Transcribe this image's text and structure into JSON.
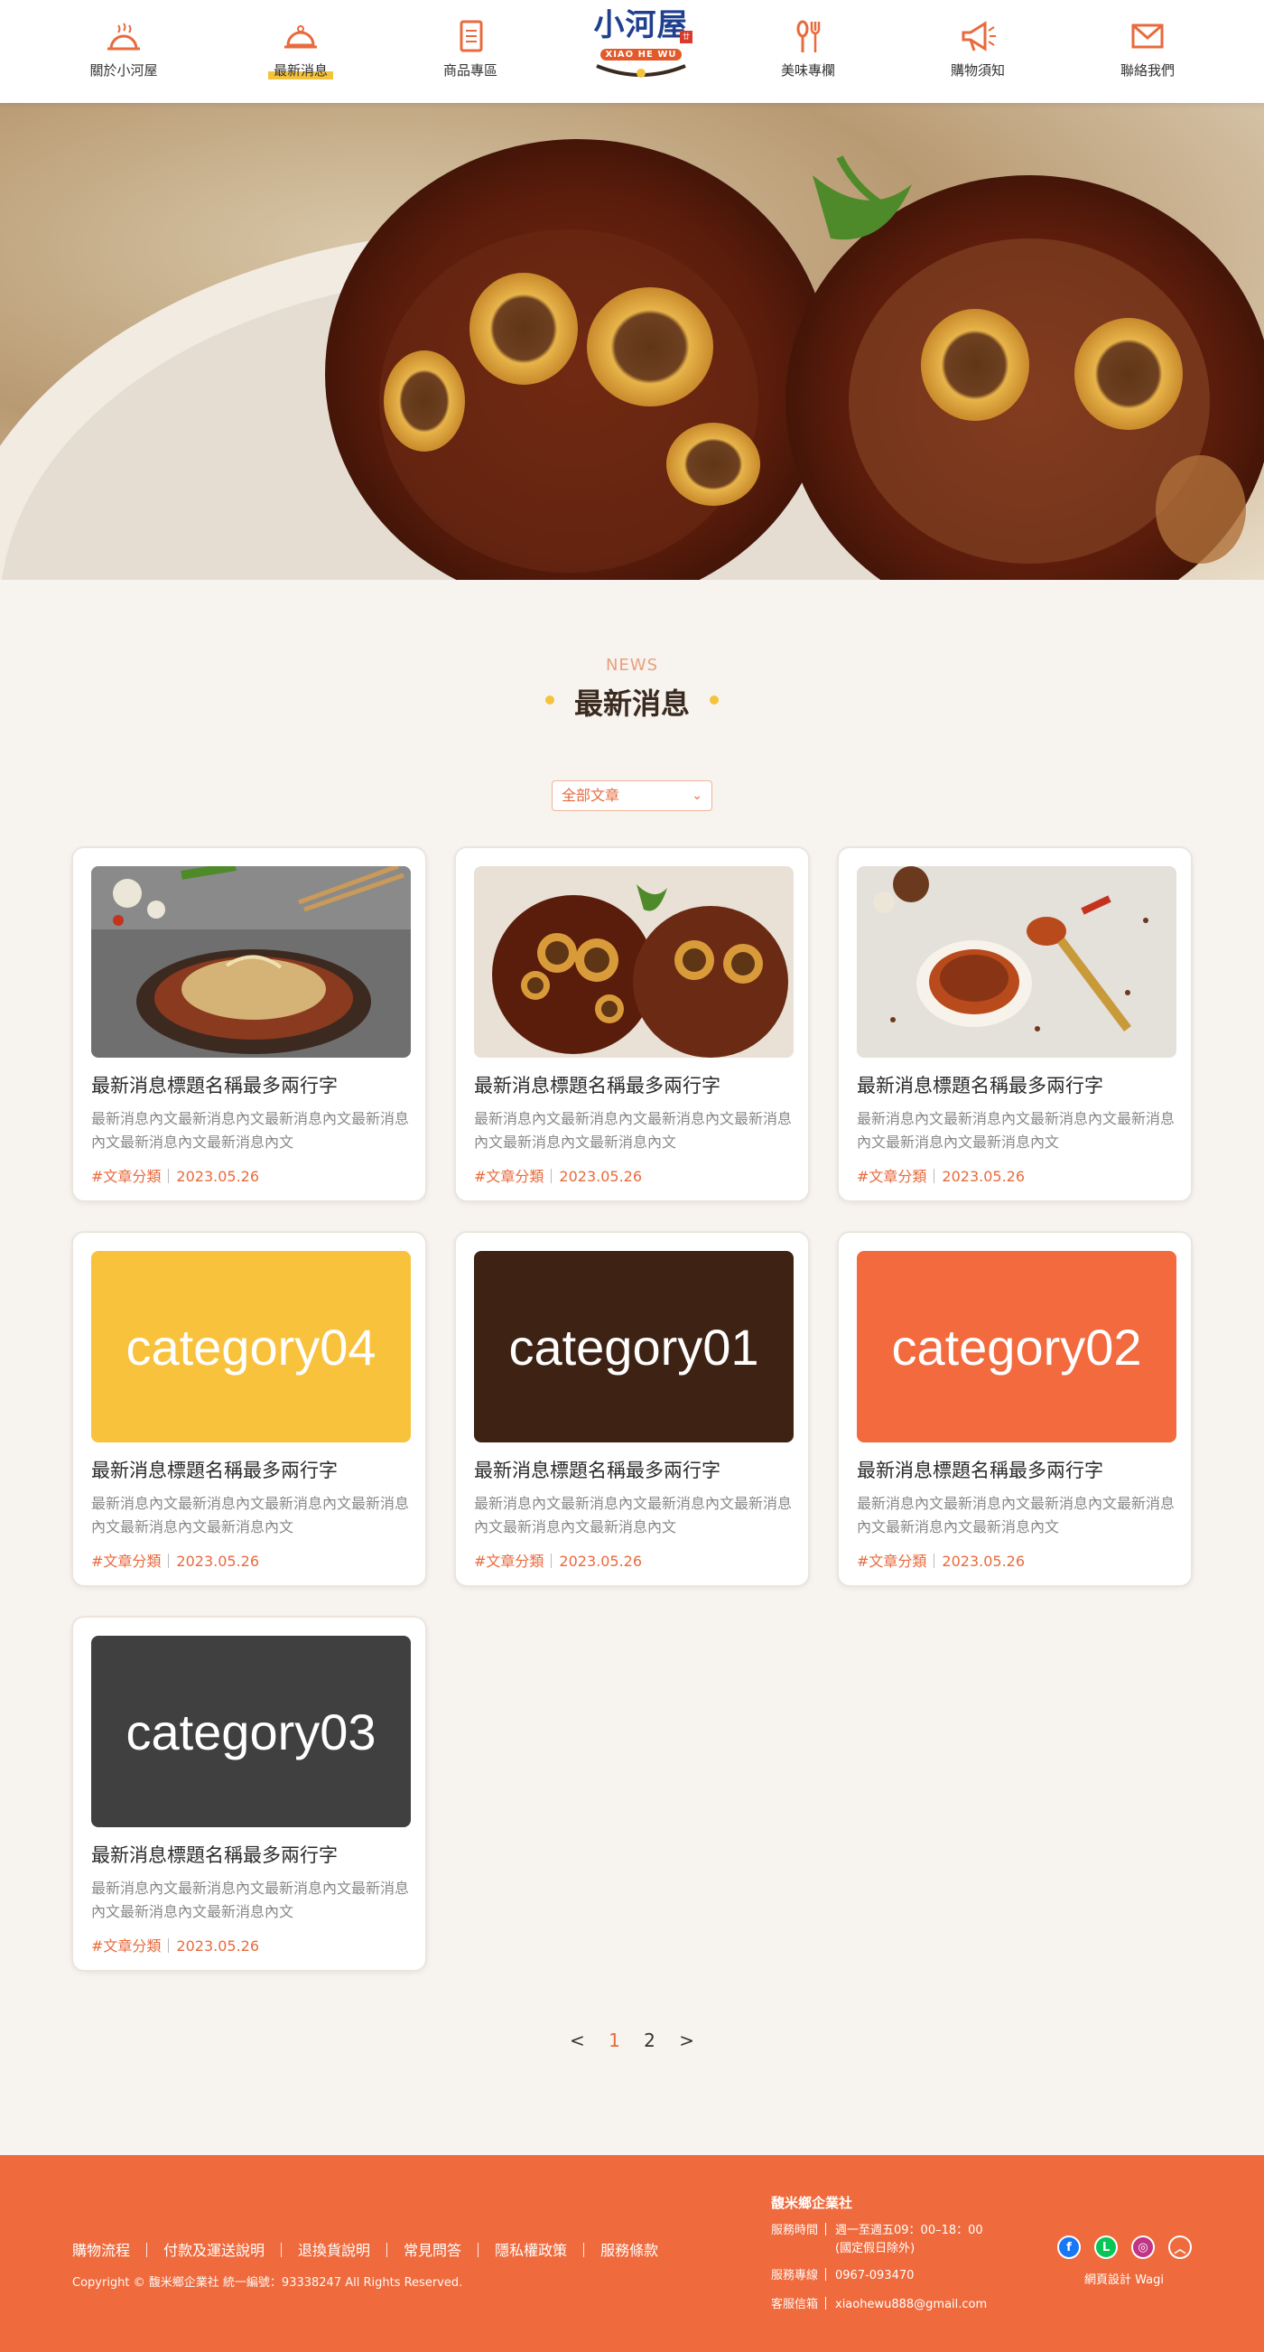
{
  "nav": {
    "items": [
      {
        "label": "關於小河屋",
        "icon": "cloche-icon"
      },
      {
        "label": "最新消息",
        "icon": "dome-icon",
        "active": true
      },
      {
        "label": "商品專區",
        "icon": "menu-icon"
      },
      {
        "label": "美味專欄",
        "icon": "spoon-fork-icon"
      },
      {
        "label": "購物須知",
        "icon": "megaphone-icon"
      },
      {
        "label": "聯絡我們",
        "icon": "mail-icon"
      }
    ],
    "logo": {
      "name": "小河屋",
      "latin": "XIAO HE WU",
      "stamp": "廿"
    }
  },
  "section": {
    "eyebrow": "NEWS",
    "title": "最新消息"
  },
  "filter": {
    "selected": "全部文章"
  },
  "cards": [
    {
      "image": "photo-food-dish",
      "title": "最新消息標題名稱最多兩行字",
      "body": "最新消息內文最新消息內文最新消息內文最新消息內文最新消息內文最新消息內文",
      "category": "#文章分類",
      "date": "2023.05.26"
    },
    {
      "image": "photo-pork-knuckle",
      "title": "最新消息標題名稱最多兩行字",
      "body": "最新消息內文最新消息內文最新消息內文最新消息內文最新消息內文最新消息內文",
      "category": "#文章分類",
      "date": "2023.05.26"
    },
    {
      "image": "photo-chili-sauce",
      "title": "最新消息標題名稱最多兩行字",
      "body": "最新消息內文最新消息內文最新消息內文最新消息內文最新消息內文最新消息內文",
      "category": "#文章分類",
      "date": "2023.05.26"
    },
    {
      "image_text": "category04",
      "image_color": "#f9c23c",
      "title": "最新消息標題名稱最多兩行字",
      "body": "最新消息內文最新消息內文最新消息內文最新消息內文最新消息內文最新消息內文",
      "category": "#文章分類",
      "date": "2023.05.26"
    },
    {
      "image_text": "category01",
      "image_color": "#3e2314",
      "title": "最新消息標題名稱最多兩行字",
      "body": "最新消息內文最新消息內文最新消息內文最新消息內文最新消息內文最新消息內文",
      "category": "#文章分類",
      "date": "2023.05.26"
    },
    {
      "image_text": "category02",
      "image_color": "#f26a3d",
      "title": "最新消息標題名稱最多兩行字",
      "body": "最新消息內文最新消息內文最新消息內文最新消息內文最新消息內文最新消息內文",
      "category": "#文章分類",
      "date": "2023.05.26"
    },
    {
      "image_text": "category03",
      "image_color": "#404040",
      "title": "最新消息標題名稱最多兩行字",
      "body": "最新消息內文最新消息內文最新消息內文最新消息內文最新消息內文最新消息內文",
      "category": "#文章分類",
      "date": "2023.05.26"
    }
  ],
  "pagination": {
    "prev": "<",
    "pages": [
      "1",
      "2"
    ],
    "current": "1",
    "next": ">"
  },
  "footer": {
    "links": [
      "購物流程",
      "付款及運送說明",
      "退換貨說明",
      "常見問答",
      "隱私權政策",
      "服務條款"
    ],
    "copyright": "Copyright © 馥米鄉企業社 統一編號：93338247 All Rights Reserved.",
    "company": "馥米鄉企業社",
    "info": [
      {
        "key": "服務時間",
        "value": "週一至週五09：00–18：00",
        "value2": "(國定假日除外)"
      },
      {
        "key": "服務專線",
        "value": "0967-093470"
      },
      {
        "key": "客服信箱",
        "value": "xiaohewu888@gmail.com"
      }
    ],
    "social": [
      {
        "icon": "facebook-icon",
        "glyph": "f",
        "color": "#1877f2"
      },
      {
        "icon": "line-icon",
        "glyph": "L",
        "color": "#06c755"
      },
      {
        "icon": "instagram-icon",
        "glyph": "◎",
        "color": "#c13584"
      },
      {
        "icon": "back-to-top-icon",
        "glyph": "︿",
        "color": "transparent"
      }
    ],
    "design_credit": "網頁設計 Wagi"
  }
}
